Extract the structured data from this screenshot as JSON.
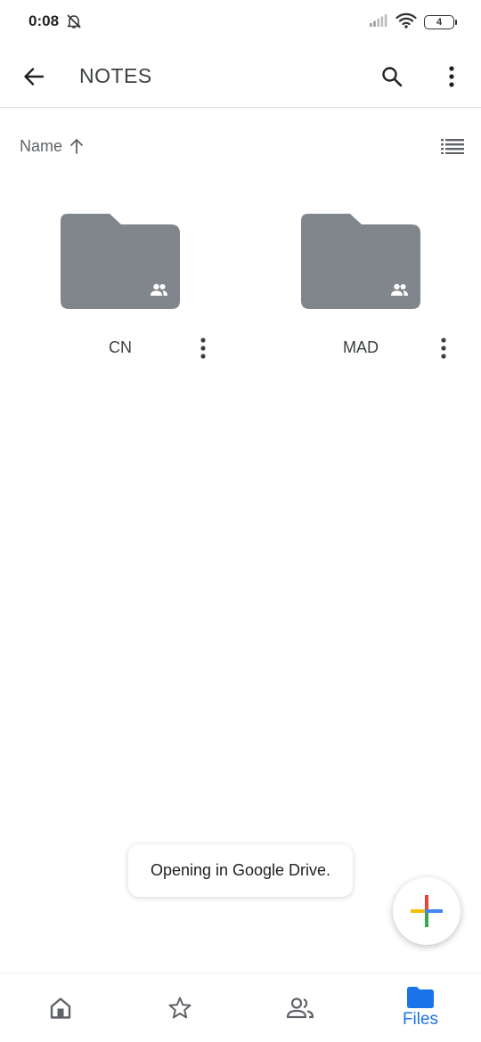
{
  "status_bar": {
    "time": "0:08",
    "battery": "4",
    "icons": [
      "bell-off-icon",
      "signal-icon",
      "wifi-icon",
      "battery-icon"
    ]
  },
  "app_bar": {
    "title": "NOTES",
    "icons": [
      "back-arrow-icon",
      "search-icon",
      "more-vert-icon"
    ]
  },
  "sort": {
    "label": "Name",
    "direction_icon": "arrow-up-icon",
    "view_icon": "list-view-icon"
  },
  "folders": [
    {
      "name": "CN",
      "icon": "shared-folder-icon",
      "color": "#80868b"
    },
    {
      "name": "MAD",
      "icon": "shared-folder-icon",
      "color": "#80868b"
    }
  ],
  "toast": {
    "text": "Opening in Google Drive."
  },
  "fab": {
    "icon": "plus-multicolor-icon",
    "colors": [
      "#ea4335",
      "#4285f4",
      "#34a853",
      "#fbbc04"
    ]
  },
  "bottom_nav": {
    "items": [
      {
        "id": "home",
        "icon": "home-icon",
        "label": ""
      },
      {
        "id": "starred",
        "icon": "star-icon",
        "label": ""
      },
      {
        "id": "shared",
        "icon": "people-icon",
        "label": ""
      },
      {
        "id": "files",
        "icon": "folder-icon",
        "label": "Files",
        "active": true
      }
    ],
    "active_color": "#1a73e8",
    "inactive_color": "#5f6368"
  }
}
